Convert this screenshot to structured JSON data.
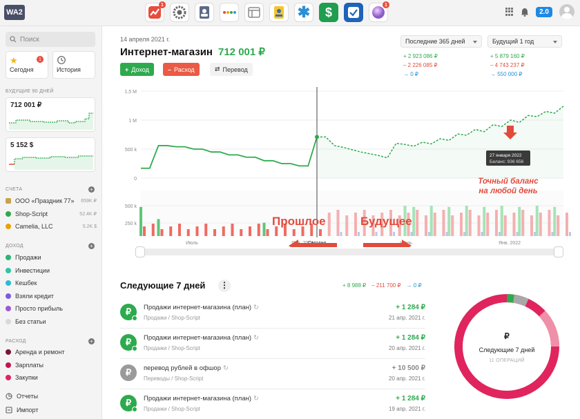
{
  "app": {
    "logo": "WA2",
    "version": "2.0"
  },
  "top_apps": [
    {
      "name": "finance-app",
      "color": "#ffffff",
      "badge": "1"
    },
    {
      "name": "gear-app",
      "color": "#ffffff",
      "badge": ""
    },
    {
      "name": "contacts-app",
      "color": "#ffffff",
      "badge": ""
    },
    {
      "name": "dots-app",
      "color": "#ffffff",
      "badge": ""
    },
    {
      "name": "window-app",
      "color": "#ffffff",
      "badge": ""
    },
    {
      "name": "id-app",
      "color": "#ffffff",
      "badge": ""
    },
    {
      "name": "asterisk-app",
      "color": "#ffffff",
      "badge": ""
    },
    {
      "name": "dollar-app",
      "color": "#1e9e4e",
      "badge": ""
    },
    {
      "name": "tasks-app",
      "color": "#1e63b8",
      "badge": ""
    },
    {
      "name": "orb-app",
      "color": "#ffffff",
      "badge": "1"
    }
  ],
  "sidebar": {
    "search_placeholder": "Поиск",
    "today": {
      "label": "Сегодня",
      "badge": "1"
    },
    "history": {
      "label": "История"
    },
    "future_title": "Будущие 90 дней",
    "mini1_value": "712 001 ₽",
    "mini2_value": "5 152 $",
    "accounts_title": "Счета",
    "accounts": [
      {
        "label": "ООО «Праздник 77»",
        "amount": "659K ₽",
        "color": "#c8a24a"
      },
      {
        "label": "Shop-Script",
        "amount": "52.4K ₽",
        "color": "#2eaa4e"
      },
      {
        "label": "Camelia, LLC",
        "amount": "5.2K $",
        "color": "#e9a200"
      }
    ],
    "income_title": "Доход",
    "income": [
      {
        "label": "Продажи",
        "color": "#2bb673"
      },
      {
        "label": "Инвестиции",
        "color": "#2ec4a6"
      },
      {
        "label": "Кешбек",
        "color": "#2bbbd8"
      },
      {
        "label": "Взяли кредит",
        "color": "#7b5ae0"
      },
      {
        "label": "Просто прибыль",
        "color": "#9b59d6"
      },
      {
        "label": "Без статьи",
        "color": "#d9d9d9"
      }
    ],
    "expense_title": "Расход",
    "expense": [
      {
        "label": "Аренда и ремонт",
        "color": "#7a1538"
      },
      {
        "label": "Зарплаты",
        "color": "#c4154f"
      },
      {
        "label": "Закупки",
        "color": "#e0245e"
      }
    ],
    "reports": "Отчеты",
    "import": "Импорт"
  },
  "main": {
    "date": "14 апреля 2021 г.",
    "title": "Интернет-магазин",
    "balance": "712 001 ₽",
    "btn_income": "Доход",
    "btn_expense": "Расход",
    "btn_transfer": "Перевод",
    "period_past": "Последние 365 дней",
    "period_future": "Будущий 1 год",
    "past_sum": {
      "income": "+ 2 923 086 ₽",
      "expense": "– 2 226 085 ₽",
      "transfer": "→ 0 ₽"
    },
    "future_sum": {
      "income": "+ 5 879 160 ₽",
      "expense": "– 4 743 237 ₽",
      "transfer": "→ 550 000 ₽"
    }
  },
  "chart_data": {
    "type": "line",
    "ylabels_top": [
      "1,5 M",
      "1 M",
      "500 k",
      "0"
    ],
    "ylabels_bottom": [
      "500 k",
      "250 k"
    ],
    "x_tick_labels": [
      "Июль",
      "Янв. 2021",
      "Сегодня",
      "Июль",
      "Янв. 2022"
    ],
    "ylim": [
      0,
      1500000
    ],
    "balance_series": {
      "name": "",
      "x_today_index": 20,
      "values": [
        170000,
        170000,
        560000,
        560000,
        540000,
        540000,
        500000,
        500000,
        450000,
        450000,
        400000,
        400000,
        360000,
        360000,
        300000,
        300000,
        250000,
        250000,
        210000,
        210000,
        710000,
        710000,
        560000,
        530000,
        490000,
        450000,
        420000,
        390000,
        350000,
        600000,
        580000,
        550000,
        620000,
        590000,
        680000,
        650000,
        760000,
        740000,
        840000,
        800000,
        920000,
        890000,
        1000000,
        960000,
        1080000,
        1060000,
        1150000,
        1120000,
        1240000
      ]
    },
    "income_bars": [
      480000,
      0,
      280000,
      0,
      0,
      0,
      0,
      0,
      0,
      0,
      0,
      0,
      0,
      0,
      220000,
      0,
      0,
      0,
      0,
      0,
      0,
      0,
      0,
      0,
      0,
      0,
      0,
      0,
      0,
      0,
      500000,
      480000,
      0,
      500000,
      0,
      480000,
      0,
      500000,
      0,
      480000,
      0,
      500000,
      0,
      480000,
      0,
      500000,
      0,
      480000,
      0
    ],
    "expense_bars": [
      0,
      0,
      0,
      0,
      0,
      0,
      0,
      0,
      0,
      0,
      0,
      0,
      0,
      0,
      0,
      0,
      0,
      0,
      0,
      0,
      0,
      0,
      0,
      0,
      0,
      0,
      0,
      0,
      0,
      0,
      0,
      0,
      0,
      0,
      0,
      0,
      0,
      0,
      0,
      0,
      0,
      0,
      0,
      0,
      0,
      0,
      0,
      0,
      0
    ],
    "tooltip": {
      "date": "27 января 2022",
      "balance": "Баланс: 936 656"
    },
    "annotations": {
      "past": "Прошлое",
      "future": "Будущее",
      "exact": "Точный баланс",
      "exact2": "на любой день"
    }
  },
  "next7": {
    "title": "Следующие 7 дней",
    "sum": {
      "income": "+ 8 988 ₽",
      "expense": "– 211 700 ₽",
      "transfer": "→ 0 ₽"
    },
    "items": [
      {
        "icon": "₽",
        "name": "Продажи интернет-магазина (план)",
        "category": "Продажи / Shop-Script",
        "amount": "+ 1 284 ₽",
        "date": "21 апр. 2021 г.",
        "kind": "green"
      },
      {
        "icon": "₽",
        "name": "Продажи интернет-магазина (план)",
        "category": "Продажи / Shop-Script",
        "amount": "+ 1 284 ₽",
        "date": "20 апр. 2021 г.",
        "kind": "green"
      },
      {
        "icon": "₽",
        "name": "перевод рублей в офшор",
        "category": "Переводы / Shop-Script",
        "amount": "+ 10 500 ₽",
        "date": "20 апр. 2021 г.",
        "kind": "grey"
      },
      {
        "icon": "₽",
        "name": "Продажи интернет-магазина (план)",
        "category": "Продажи / Shop-Script",
        "amount": "+ 1 284 ₽",
        "date": "19 апр. 2021 г.",
        "kind": "green"
      }
    ],
    "donut": {
      "currency": "₽",
      "label": "Следующие 7 дней",
      "count": "11 ОПЕРАЦИЙ"
    }
  }
}
